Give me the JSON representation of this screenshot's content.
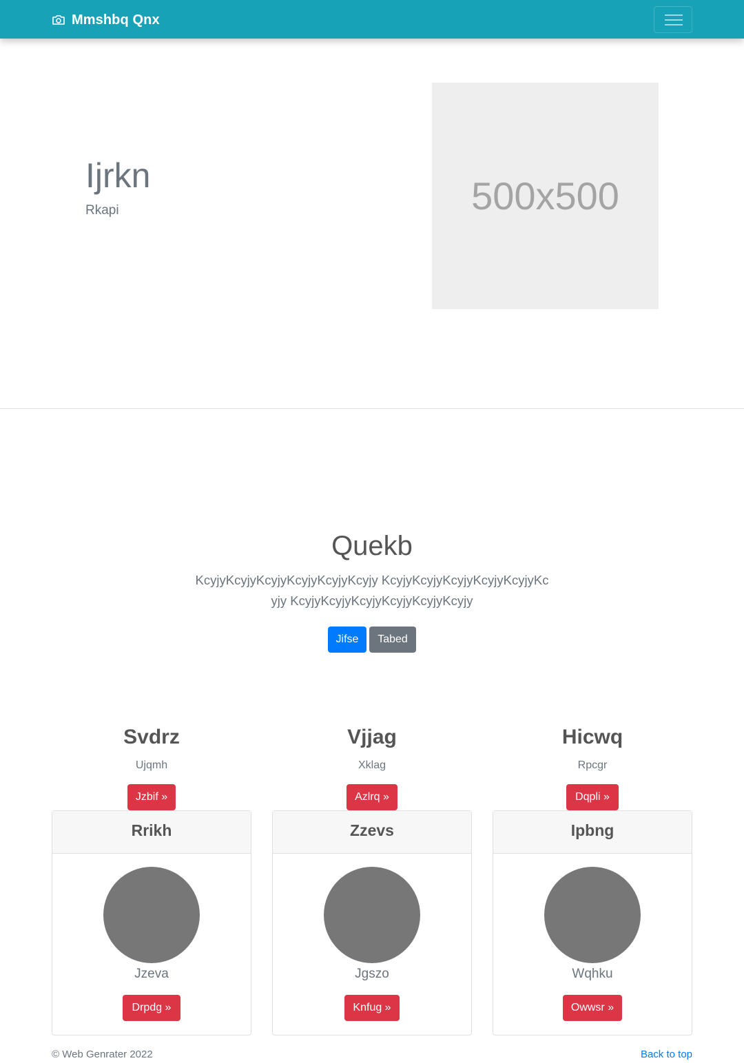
{
  "navbar": {
    "brand": "Mmshbq Qnx",
    "brand_icon": "camera-icon",
    "toggler_icon": "hamburger-icon"
  },
  "hero": {
    "title": "Ijrkn",
    "subtitle": "Rkapi",
    "image_placeholder": "500x500"
  },
  "feature": {
    "title": "Quekb",
    "text": "KcyjyKcyjyKcyjyKcyjyKcyjyKcyjy KcyjyKcyjyKcyjyKcyjyKcyjyKcyjy KcyjyKcyjyKcyjyKcyjyKcyjyKcyjy",
    "primary_button": "Jifse",
    "secondary_button": "Tabed"
  },
  "columns": [
    {
      "title": "Svdrz",
      "subtitle": "Ujqmh",
      "button": "Jzbif »"
    },
    {
      "title": "Vjjag",
      "subtitle": "Xklag",
      "button": "Azlrq »"
    },
    {
      "title": "Hicwq",
      "subtitle": "Rpcgr",
      "button": "Dqpli »"
    }
  ],
  "cards": [
    {
      "header": "Rrikh",
      "name": "Jzeva",
      "button": "Drpdg »"
    },
    {
      "header": "Zzevs",
      "name": "Jgszo",
      "button": "Knfug »"
    },
    {
      "header": "Ipbng",
      "name": "Wqhku",
      "button": "Owwsr »"
    }
  ],
  "footer": {
    "copyright": "© Web Genrater 2022",
    "back_to_top": "Back to top"
  },
  "colors": {
    "navbar": "#17a2b8",
    "primary": "#007bff",
    "secondary": "#6c757d",
    "danger": "#dc3545",
    "avatar": "#777777"
  }
}
